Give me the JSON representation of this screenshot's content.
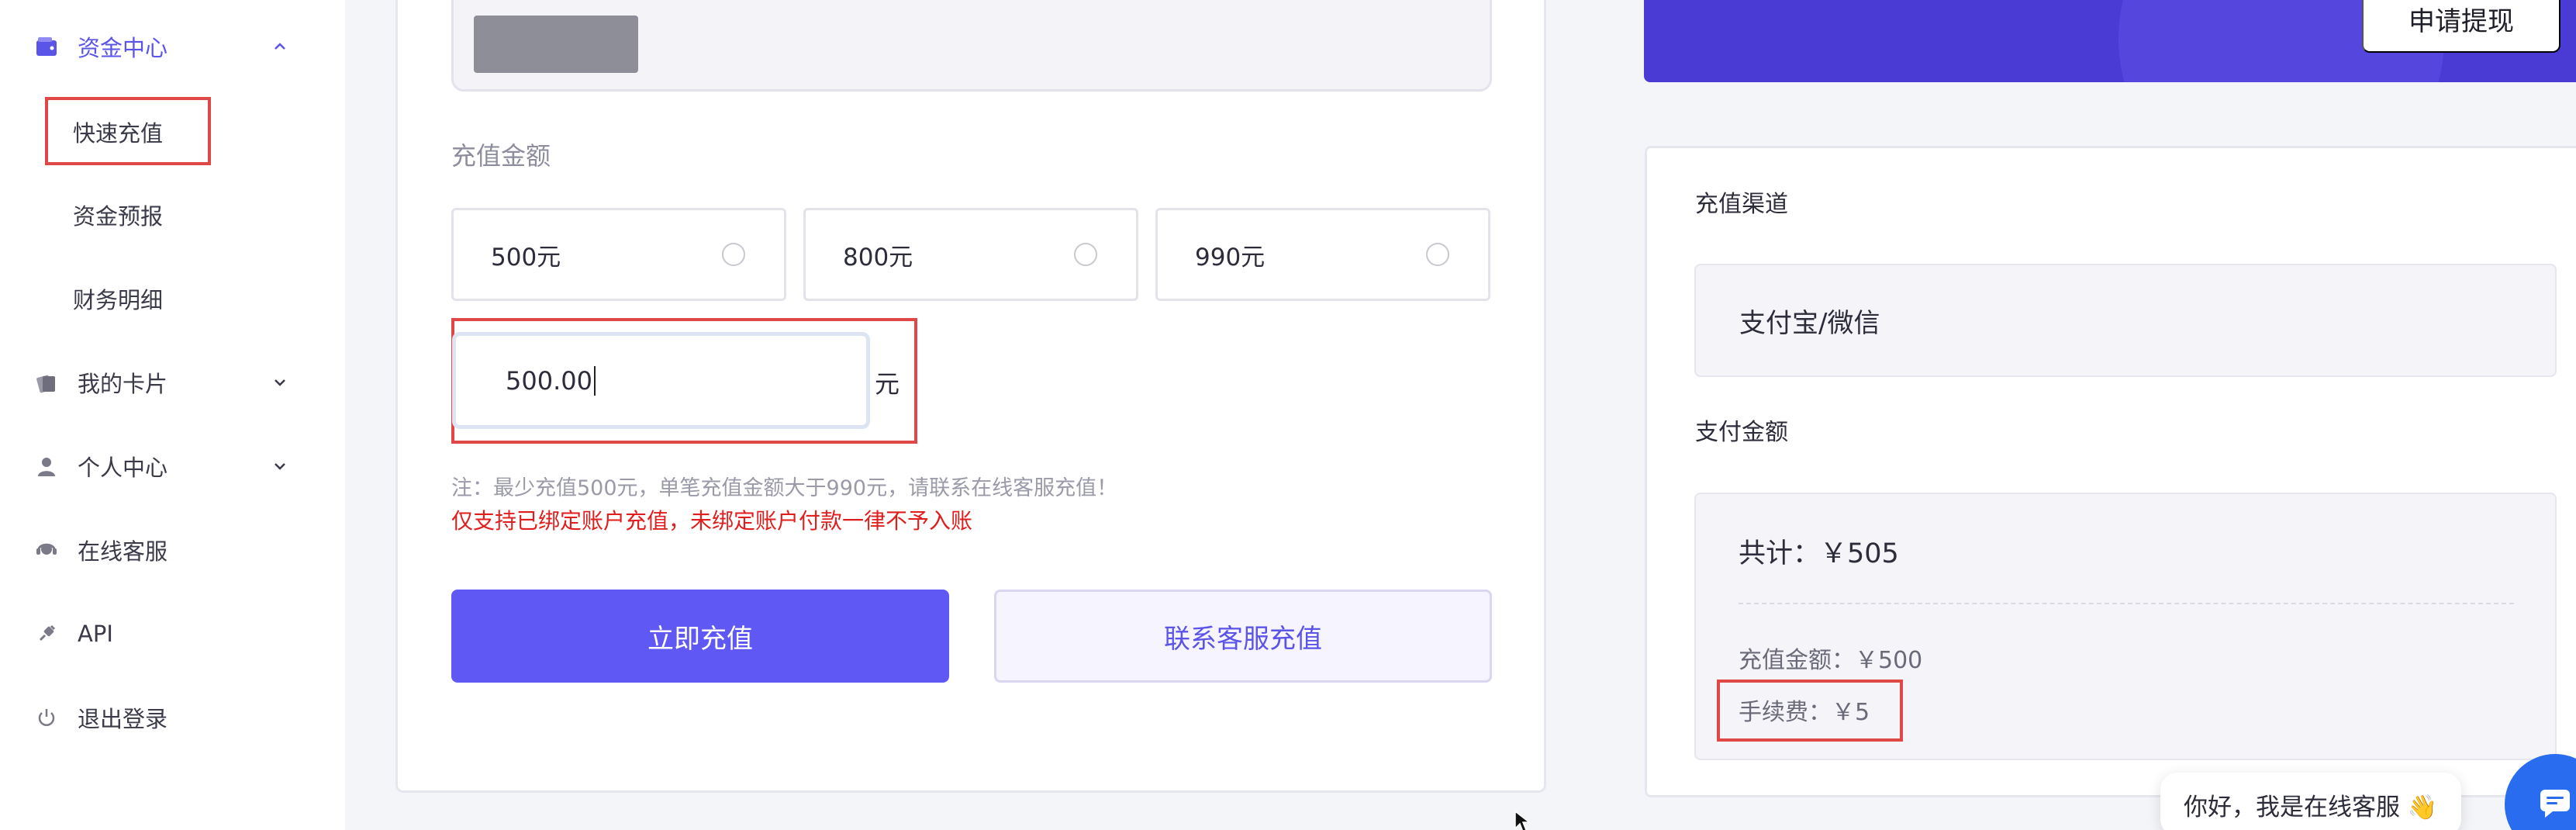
{
  "sidebar": {
    "items": [
      {
        "label": "资金中心",
        "icon": "wallet-icon",
        "expanded": true
      },
      {
        "label": "我的卡片",
        "icon": "card-icon",
        "expanded": false
      },
      {
        "label": "个人中心",
        "icon": "user-icon",
        "expanded": false
      },
      {
        "label": "在线客服",
        "icon": "headset-icon"
      },
      {
        "label": "API",
        "icon": "api-icon"
      },
      {
        "label": "退出登录",
        "icon": "power-icon"
      }
    ],
    "sub_items": [
      {
        "label": "快速充值"
      },
      {
        "label": "资金预报"
      },
      {
        "label": "财务明细"
      }
    ]
  },
  "recharge": {
    "amount_label": "充值金额",
    "options": [
      {
        "label": "500元"
      },
      {
        "label": "800元"
      },
      {
        "label": "990元"
      }
    ],
    "custom_value": "500.00",
    "unit": "元",
    "note": "注：最少充值500元，单笔充值金额大于990元，请联系在线客服充值！",
    "warning": "仅支持已绑定账户充值，未绑定账户付款一律不予入账",
    "submit_label": "立即充值",
    "contact_label": "联系客服充值"
  },
  "header": {
    "withdraw_label": "申请提现"
  },
  "payment": {
    "channel_label": "充值渠道",
    "channel_value": "支付宝/微信",
    "amount_label": "支付金额",
    "total": "共计：￥505",
    "recharge_amount": "充值金额：￥500",
    "fee": "手续费：￥5"
  },
  "chat": {
    "greeting": "你好，我是在线客服 👋"
  },
  "colors": {
    "accent": "#6058f5",
    "banner": "#4a3bd4",
    "highlight": "#e04848",
    "warning": "#e01e1e"
  }
}
